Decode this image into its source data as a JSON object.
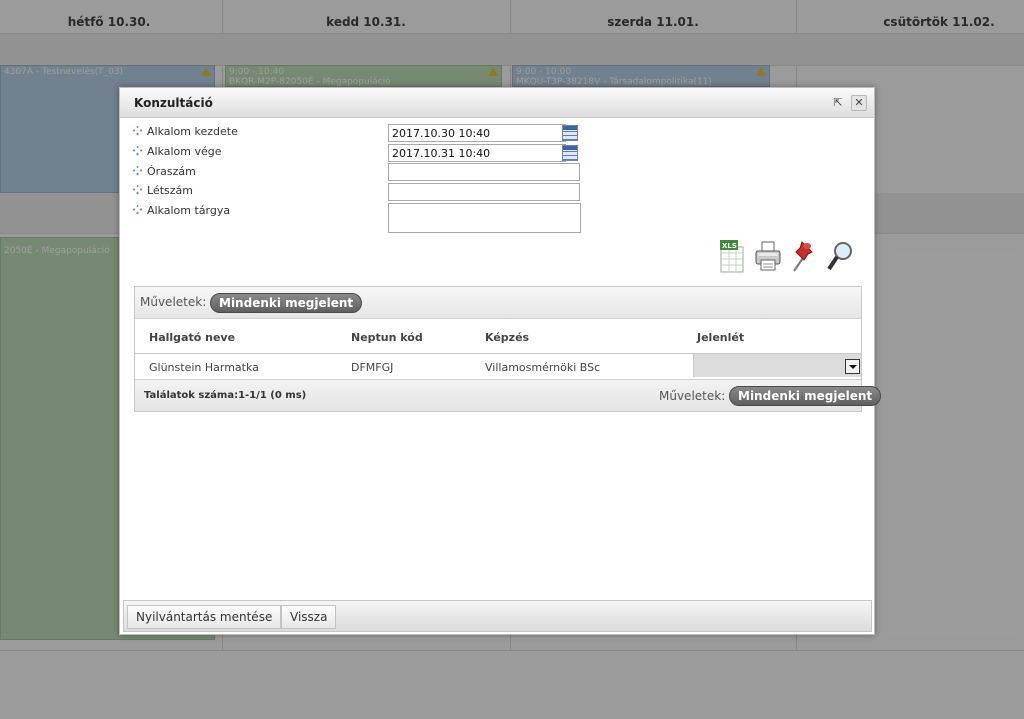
{
  "calendar": {
    "days": [
      "hétfő 10.30.",
      "kedd 10.31.",
      "szerda 11.01.",
      "csütörtök 11.02."
    ],
    "events": [
      {
        "time": "",
        "title": "4307A - Testnevelés(T_03)"
      },
      {
        "time": "9:00 - 10:40",
        "title": "BKQR-M2P-82050É - Megapopuláció"
      },
      {
        "time": "9:00 - 10:00",
        "title": "MKQU-T3P-38218V - Társadalompolitika(11)"
      },
      {
        "time": "",
        "title": "2050É - Megapopuláció"
      }
    ]
  },
  "dialog": {
    "title": "Konzultáció",
    "form": {
      "start_label": "Alkalom kezdete",
      "start_value": "2017.10.30 10:40",
      "end_label": "Alkalom vége",
      "end_value": "2017.10.31 10:40",
      "hours_label": "Óraszám",
      "hours_value": "",
      "headcount_label": "Létszám",
      "headcount_value": "",
      "subject_label": "Alkalom tárgya",
      "subject_value": ""
    },
    "tool_icons": [
      "xls-export-icon",
      "print-icon",
      "pin-icon",
      "search-icon"
    ],
    "xls_badge": "XLS",
    "grid": {
      "ops_label": "Műveletek:",
      "all_present_label": "Mindenki megjelent",
      "columns": [
        "Hallgató neve",
        "Neptun kód",
        "Képzés",
        "Jelenlét"
      ],
      "rows": [
        {
          "name": "Glünstein Harmatka",
          "neptun": "DFMFGJ",
          "program": "Villamosmérnöki BSc",
          "attendance": ""
        }
      ],
      "result_count": "Találatok száma:1-1/1 (0 ms)"
    },
    "buttons": {
      "save": "Nyilvántartás mentése",
      "back": "Vissza"
    },
    "popout_glyph": "⇱",
    "close_glyph": "✕"
  }
}
